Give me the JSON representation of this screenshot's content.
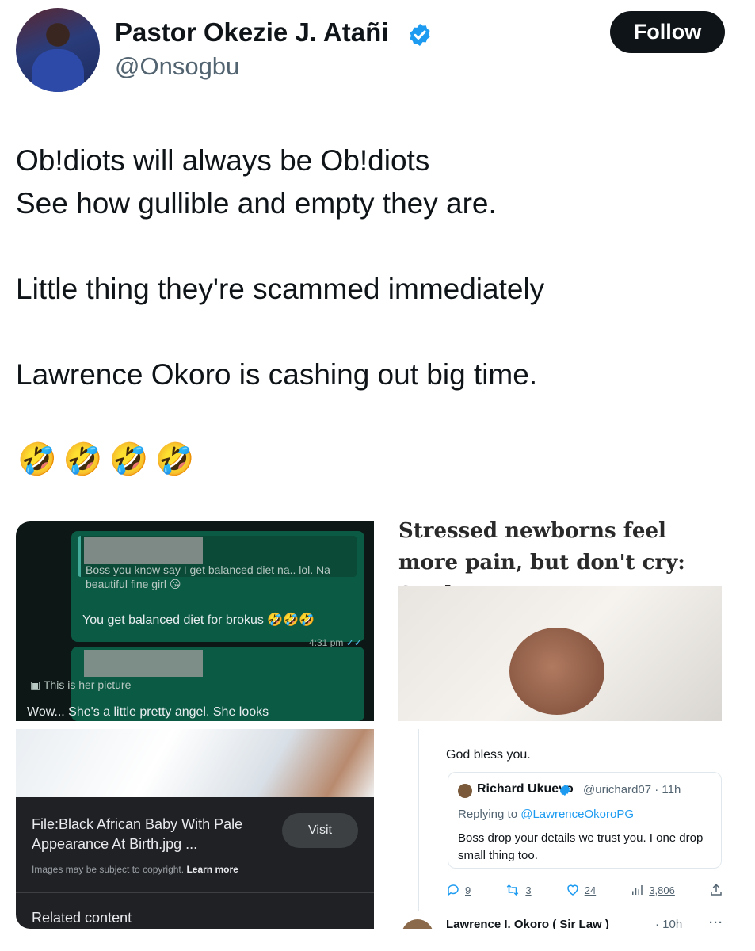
{
  "author": {
    "display_name": "Pastor Okezie J. Atañi",
    "handle": "@Onsogbu",
    "verified": true,
    "verified_color": "#1d9bf0"
  },
  "follow_label": "Follow",
  "tweet": {
    "lines": [
      "Ob!diots will always be Ob!diots",
      "See how gullible and empty they are.",
      "Little thing they're scammed immediately",
      "Lawrence Okoro is cashing out big time."
    ],
    "emojis": [
      "🤣",
      "🤣",
      "🤣",
      "🤣"
    ]
  },
  "whatsapp": {
    "quote_text": "Boss you know say I get balanced diet na.. lol. Na beautiful fine girl 😘",
    "message": "You get balanced diet for brokus 🤣🤣🤣",
    "time": "4:31 pm",
    "quote2_text": "This is her picture",
    "message2": "Wow... She's a little pretty angel. She looks",
    "heart_eyes_emoji": "😍"
  },
  "news": {
    "headline": "Stressed newborns feel more pain, but don't cry: Study"
  },
  "image_search": {
    "title": "File:Black African Baby With Pale Appearance At Birth.jpg ...",
    "visit_label": "Visit",
    "copyright_note": "Images may be subject to copyright.",
    "learn_more": "Learn more",
    "related": "Related content"
  },
  "reply_thread": {
    "reply_text": "God bless you.",
    "quoted": {
      "name": "Richard Ukuevo",
      "handle": "@urichard07 · 11h",
      "replying_to_prefix": "Replying to",
      "replying_to": "@LawrenceOkoroPG",
      "body": "Boss drop your details we trust you. I one drop small thing too."
    },
    "actions": {
      "replies": "9",
      "retweets": "3",
      "likes": "24",
      "views": "3,806"
    },
    "next_reply_name": "Lawrence I. Okoro ( Sir Law )",
    "next_reply_time": "· 10h",
    "next_reply_more": "···"
  }
}
